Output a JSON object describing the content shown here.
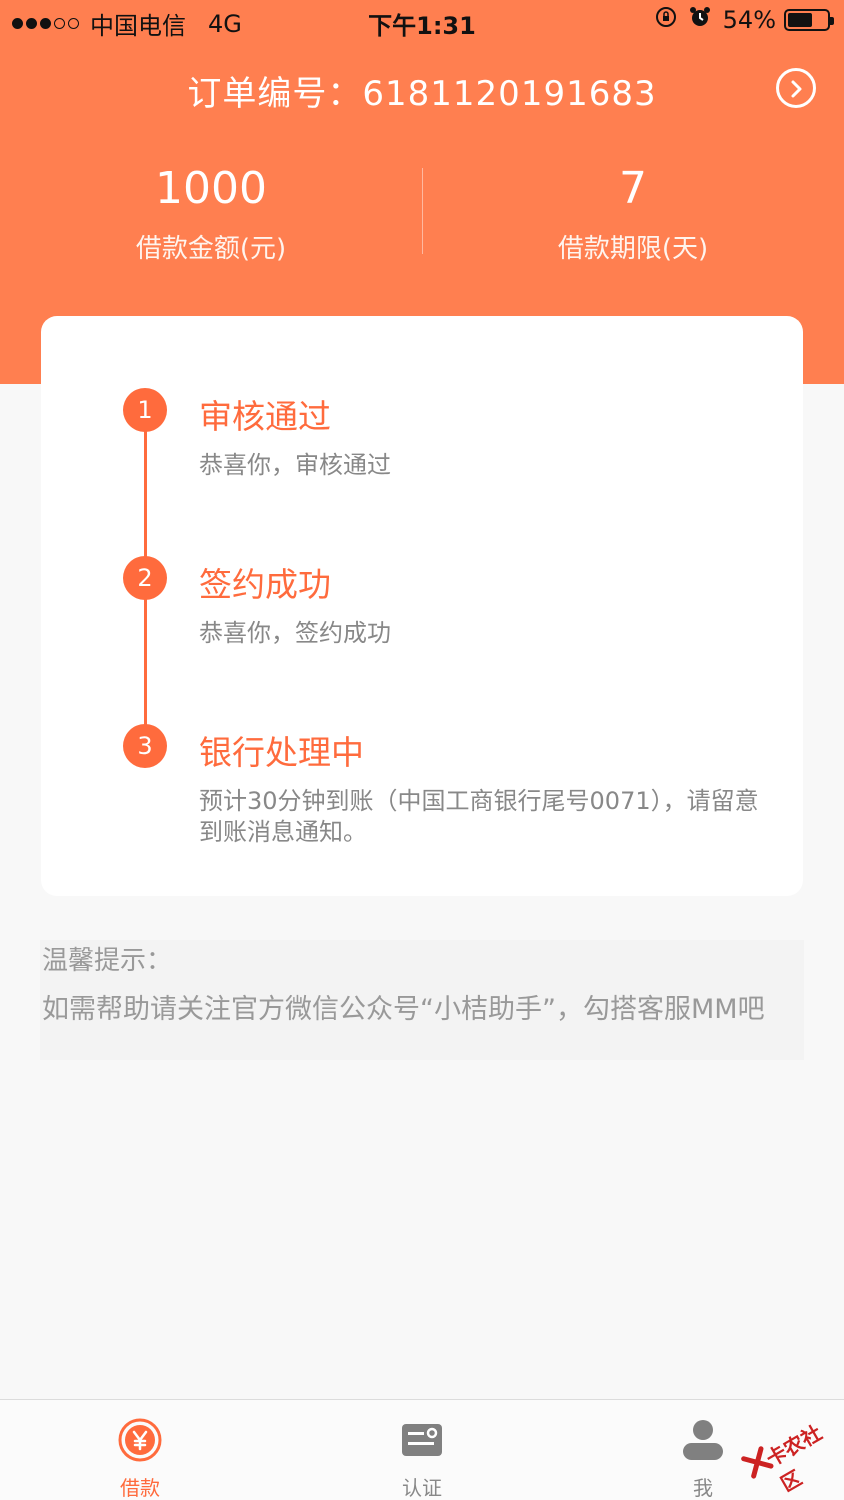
{
  "status_bar": {
    "carrier": "中国电信",
    "network": "4G",
    "time": "下午1:31",
    "battery": "54%"
  },
  "order": {
    "label": "订单编号：",
    "number": "6181120191683"
  },
  "stats": {
    "amount_value": "1000",
    "amount_label": "借款金额(元)",
    "term_value": "7",
    "term_label": "借款期限(天)"
  },
  "steps": [
    {
      "num": "1",
      "title": "审核通过",
      "desc": "恭喜你，审核通过"
    },
    {
      "num": "2",
      "title": "签约成功",
      "desc": "恭喜你，签约成功"
    },
    {
      "num": "3",
      "title": "银行处理中",
      "desc": "预计30分钟到账（中国工商银行尾号0071），请留意到账消息通知。"
    }
  ],
  "tip": {
    "title": "温馨提示：",
    "body": "如需帮助请关注官方微信公众号“小桔助手”，勾搭客服MM吧"
  },
  "tabs": [
    {
      "label": "借款",
      "icon": "yen-circle-icon",
      "active": true
    },
    {
      "label": "认证",
      "icon": "id-card-icon",
      "active": false
    },
    {
      "label": "我",
      "icon": "person-icon",
      "active": false
    }
  ],
  "watermark": "卡农社区",
  "colors": {
    "brand": "#ff7f50",
    "accent": "#ff6b3d"
  }
}
